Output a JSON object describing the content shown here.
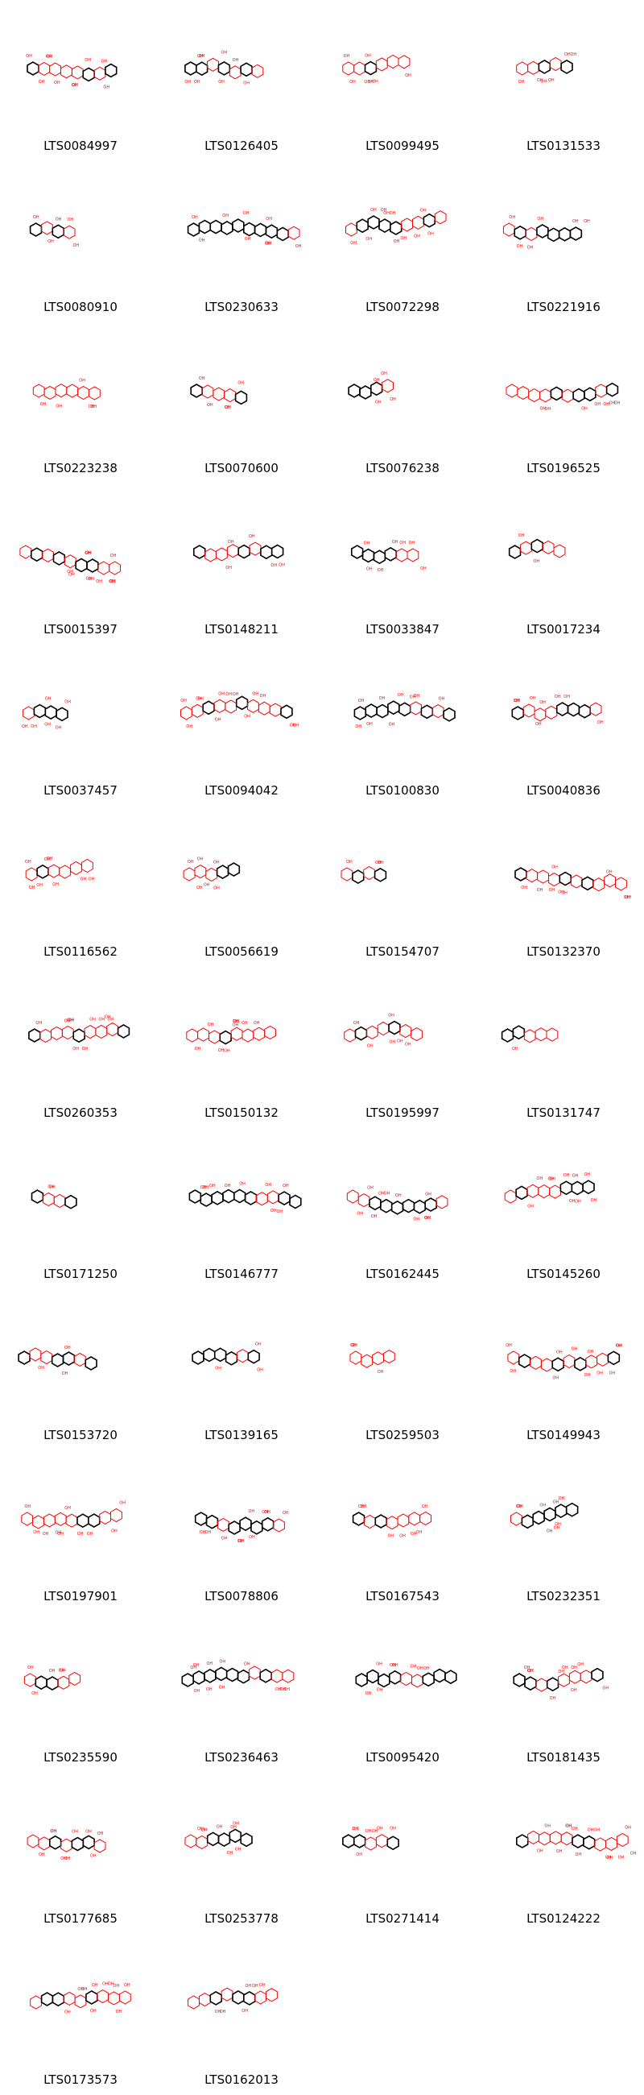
{
  "grid": {
    "compounds": [
      "LTS0084997",
      "LTS0126405",
      "LTS0099495",
      "LTS0131533",
      "LTS0080910",
      "LTS0230633",
      "LTS0072298",
      "LTS0221916",
      "LTS0223238",
      "LTS0070600",
      "LTS0076238",
      "LTS0196525",
      "LTS0015397",
      "LTS0148211",
      "LTS0033847",
      "LTS0017234",
      "LTS0037457",
      "LTS0094042",
      "LTS0100830",
      "LTS0040836",
      "LTS0116562",
      "LTS0056619",
      "LTS0154707",
      "LTS0132370",
      "LTS0260353",
      "LTS0150132",
      "LTS0195997",
      "LTS0131747",
      "LTS0171250",
      "LTS0146777",
      "LTS0162445",
      "LTS0145260",
      "LTS0153720",
      "LTS0139165",
      "LTS0259503",
      "LTS0149943",
      "LTS0197901",
      "LTS0078806",
      "LTS0167543",
      "LTS0232351",
      "LTS0235590",
      "LTS0236463",
      "LTS0095420",
      "LTS0181435",
      "LTS0177685",
      "LTS0253778",
      "LTS0271414",
      "LTS0124222",
      "LTS0173573",
      "LTS0162013"
    ]
  },
  "colors": {
    "bond": "#000000",
    "oxygen": "#ff0000",
    "nitrogen": "#0000ff",
    "label": "#000000",
    "background": "#ffffff"
  }
}
